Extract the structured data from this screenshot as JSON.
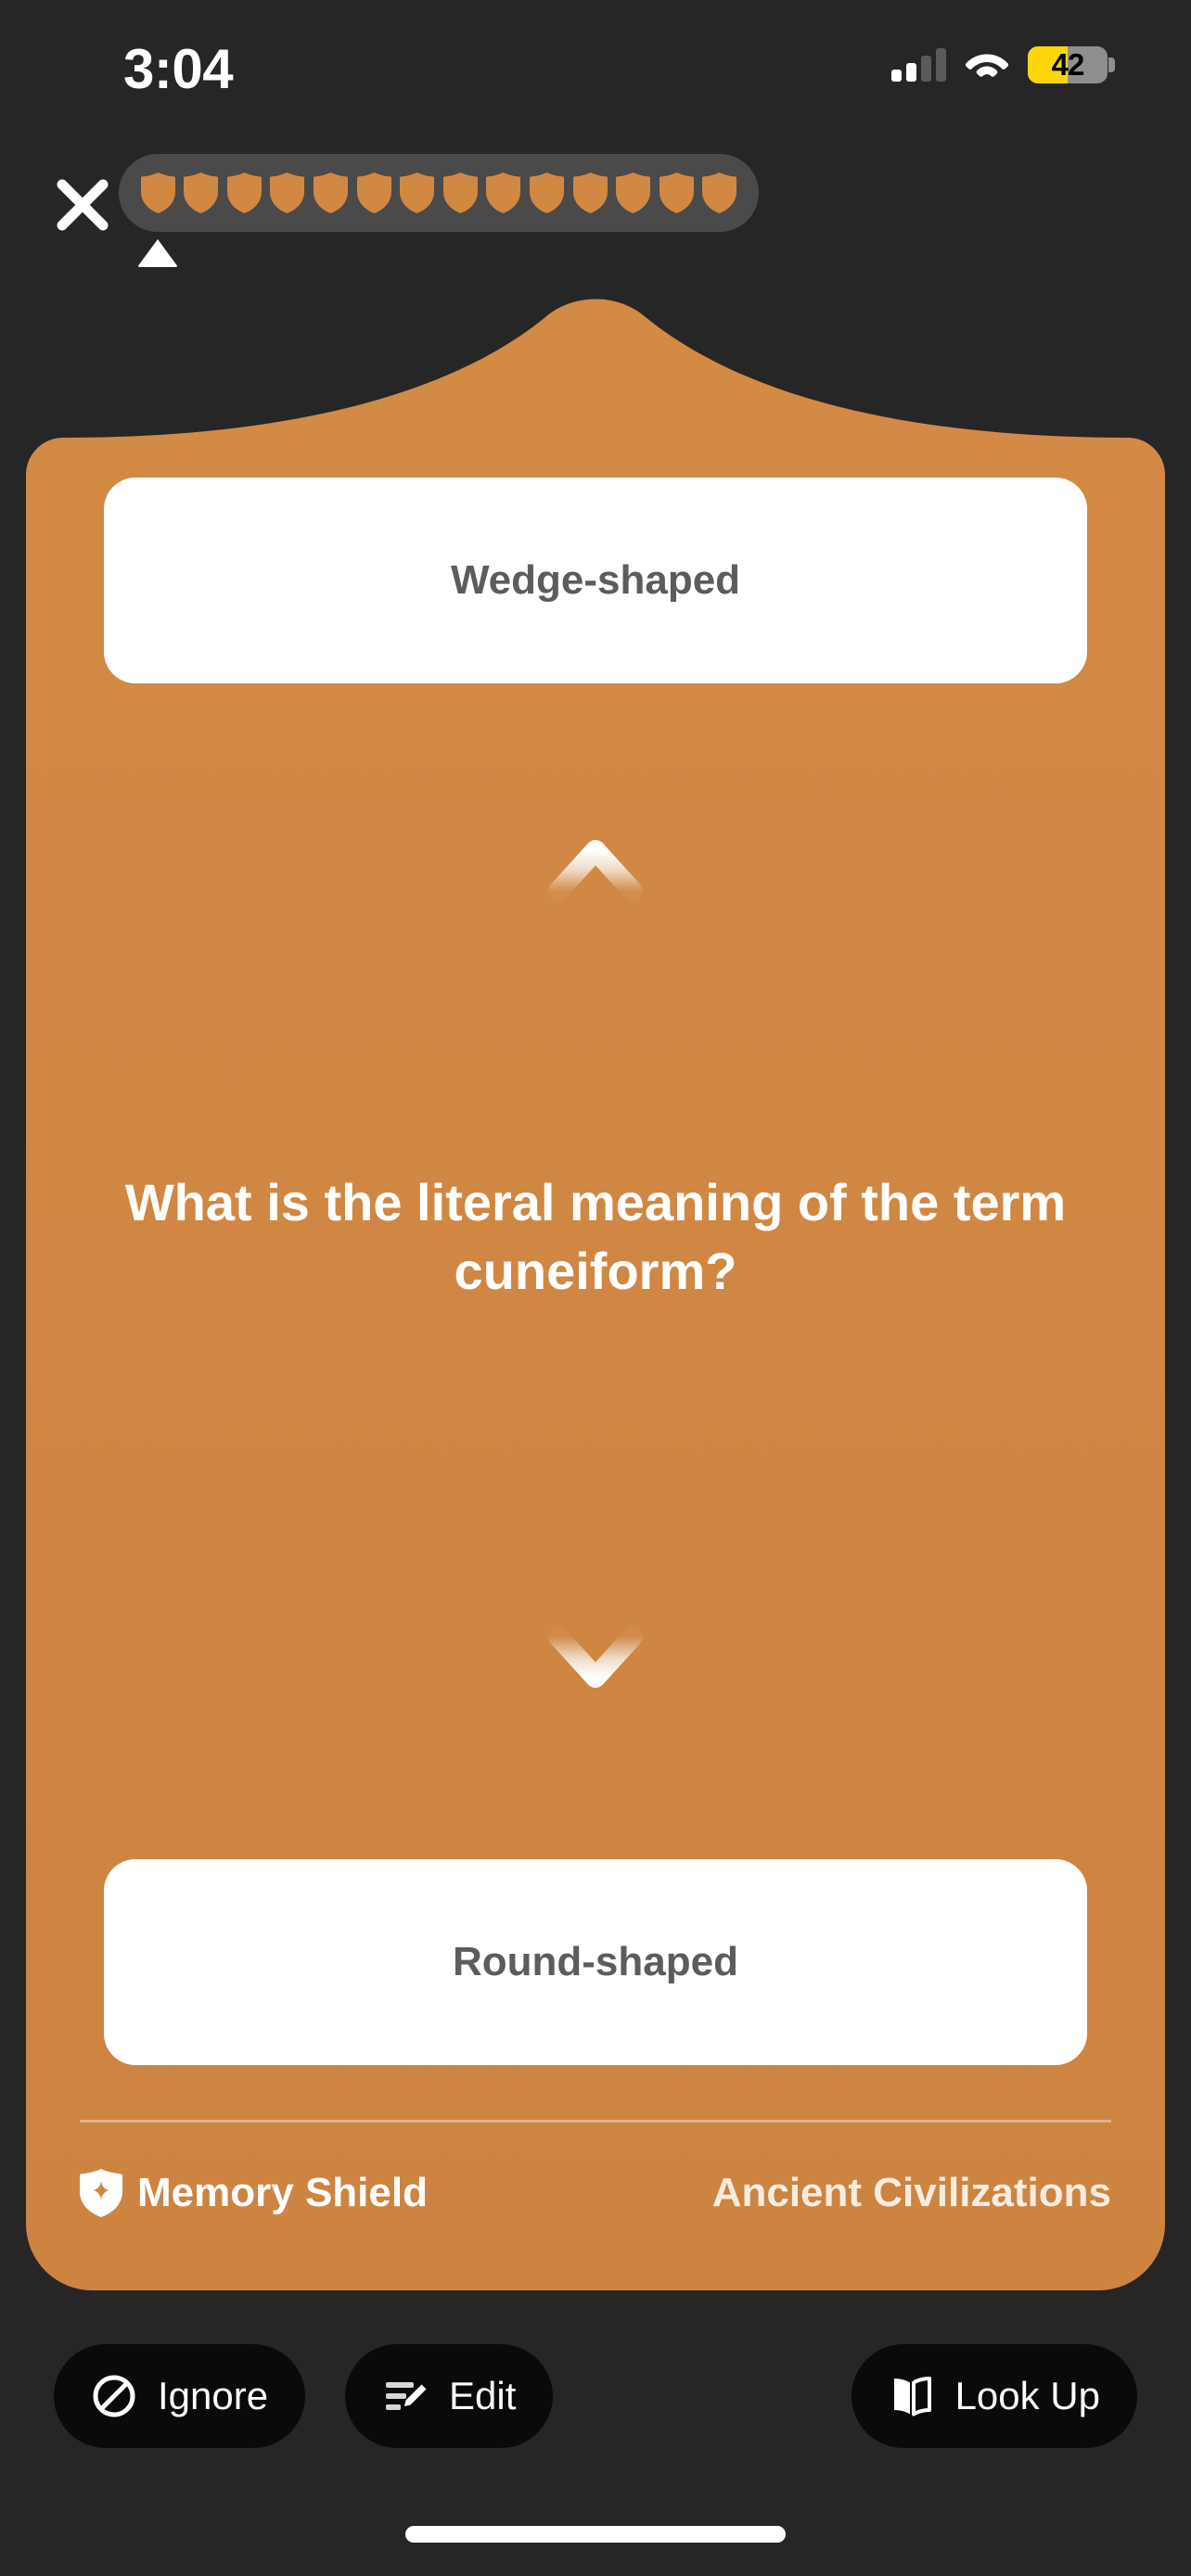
{
  "status_bar": {
    "time": "3:04",
    "signal_icon": "cellular-signal-icon",
    "signal_bars_total": 4,
    "signal_bars_active": 2,
    "wifi_icon": "wifi-icon",
    "battery_icon": "battery-icon",
    "battery_percent": "42",
    "battery_level": 42,
    "battery_color": "#ffd60a"
  },
  "topbar": {
    "close_icon": "close-icon",
    "progress": {
      "total_pips": 14,
      "completed_pips": 14,
      "pip_icon": "shield-pip-icon",
      "pip_color": "#d08843",
      "track_color": "#4a4a4a",
      "caret_icon": "position-caret-icon"
    }
  },
  "card": {
    "background_color": "#d08843",
    "top_answer": {
      "label": "Wedge-shaped",
      "text_color": "#5c5c5c"
    },
    "bottom_answer": {
      "label": "Round-shaped",
      "text_color": "#5c5c5c"
    },
    "up_arrow_icon": "arrow-up-icon",
    "down_arrow_icon": "arrow-down-icon",
    "question": "What is the literal meaning of the term cuneiform?",
    "footer": {
      "mode_icon": "memory-shield-icon",
      "mode_label": "Memory Shield",
      "deck_label": "Ancient Civilizations"
    }
  },
  "actions": {
    "ignore": {
      "label": "Ignore",
      "icon": "prohibited-icon"
    },
    "edit": {
      "label": "Edit",
      "icon": "list-edit-pencil-icon"
    },
    "lookup": {
      "label": "Look Up",
      "icon": "open-book-icon"
    }
  },
  "system": {
    "home_indicator": "home-indicator"
  }
}
